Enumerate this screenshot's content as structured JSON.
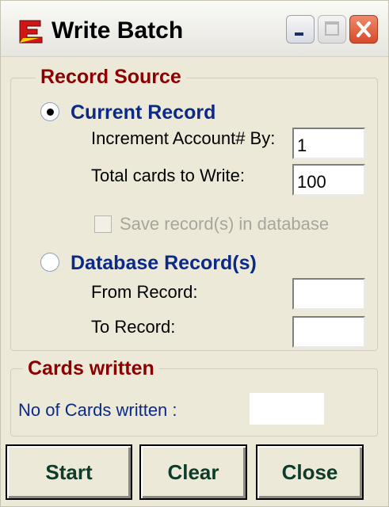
{
  "window": {
    "title": "Write Batch"
  },
  "record_source": {
    "group_title": "Record Source",
    "current_record": {
      "label": "Current Record",
      "selected": true,
      "increment_label": "Increment Account# By:",
      "increment_value": "1",
      "total_label": "Total cards to Write:",
      "total_value": "100",
      "save_label": "Save record(s) in database",
      "save_checked": false,
      "save_enabled": false
    },
    "database_records": {
      "label": "Database Record(s)",
      "selected": false,
      "from_label": "From Record:",
      "from_value": "",
      "to_label": "To Record:",
      "to_value": ""
    }
  },
  "cards_written": {
    "group_title": "Cards written",
    "count_label": "No of Cards written :",
    "count_value": ""
  },
  "buttons": {
    "start": "Start",
    "clear": "Clear",
    "close": "Close"
  },
  "colors": {
    "group_title": "#8b0000",
    "radio_label": "#0b2a88",
    "button_text": "#0e3b2a",
    "close_button": "#d64a2a"
  }
}
